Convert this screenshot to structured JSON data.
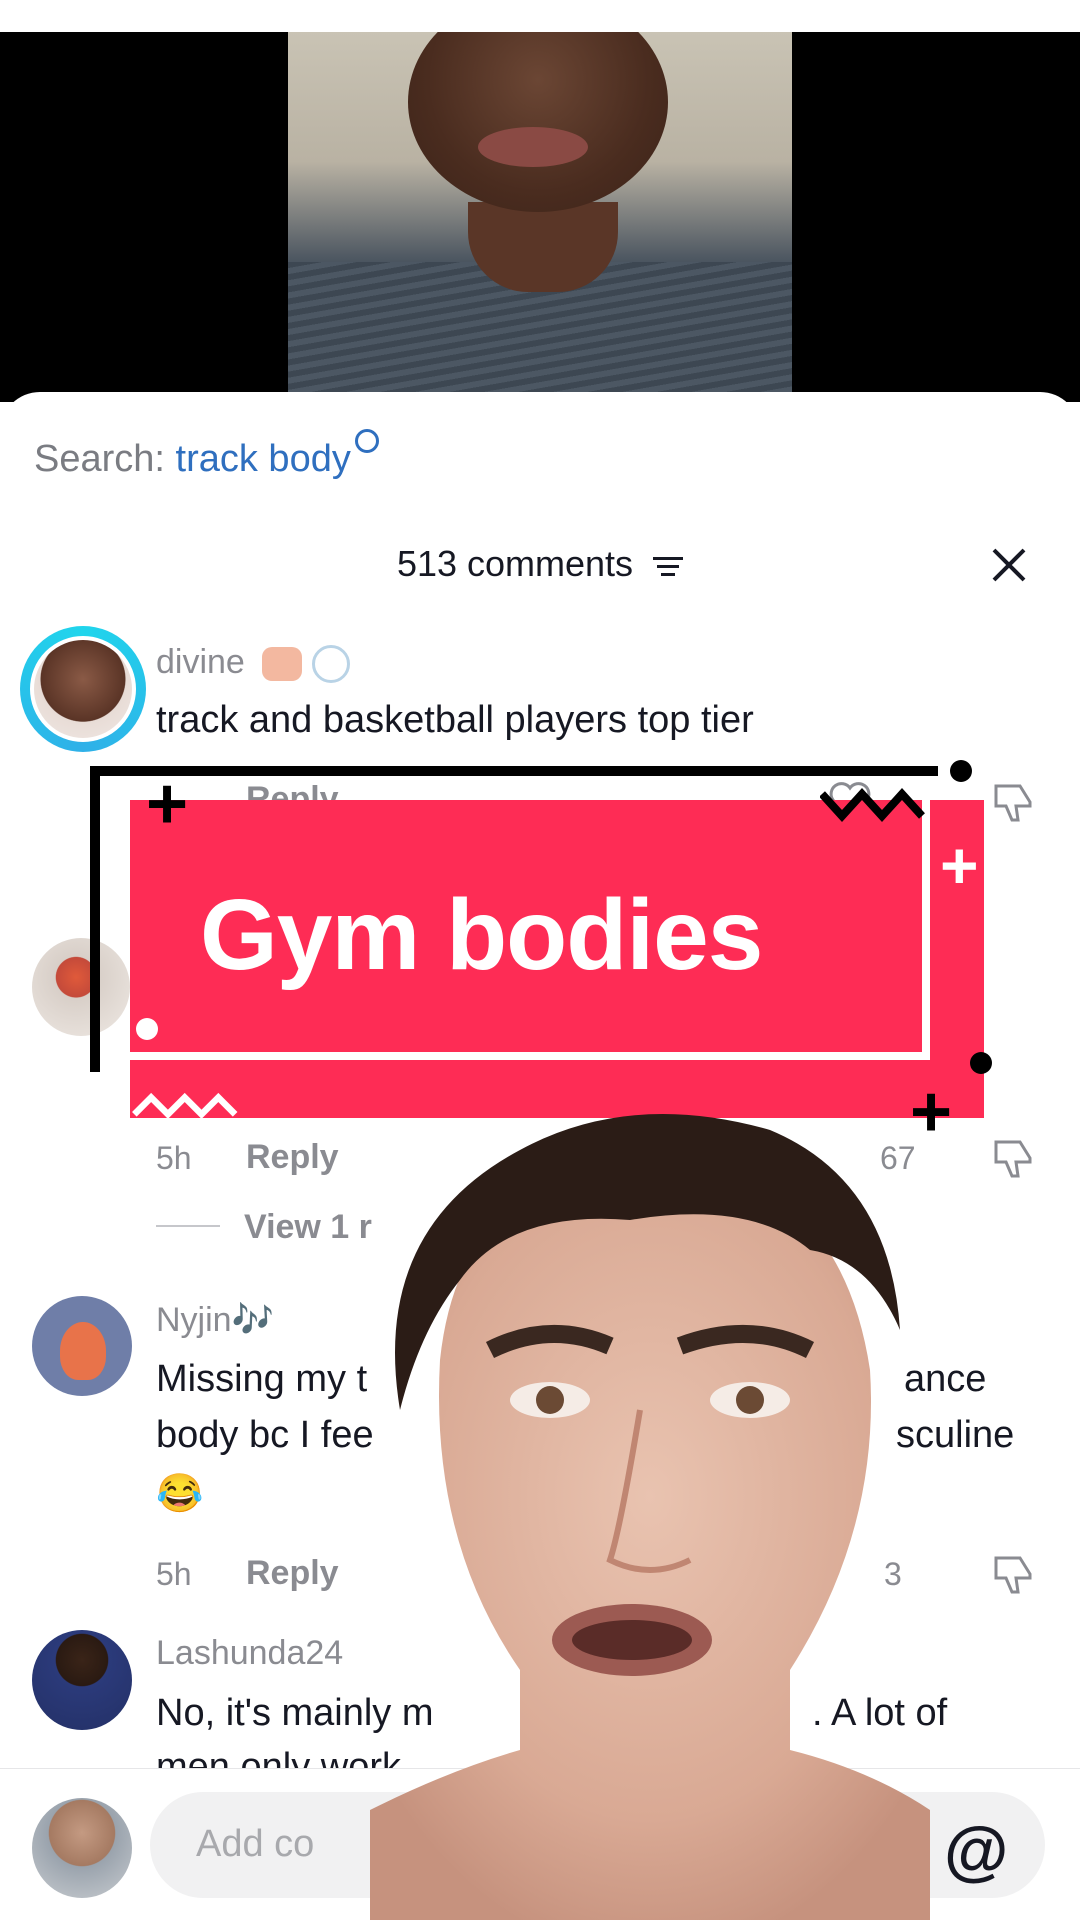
{
  "search": {
    "label": "Search:",
    "query": "track body"
  },
  "header": {
    "comment_count": "513 comments"
  },
  "comments": [
    {
      "username": "divine",
      "text": "track and basketball players top tier",
      "reply_label": "Reply"
    },
    {
      "time": "5h",
      "reply_label": "Reply",
      "likes": "67",
      "view_replies": "View 1 r"
    },
    {
      "username": "Nyjin🎶",
      "text_line1": "Missing my t",
      "text_line1_right": "ance",
      "text_line2": "body bc I fee",
      "text_line2_right": "sculine",
      "emoji": "😂",
      "time": "5h",
      "reply_label": "Reply",
      "likes": "3"
    },
    {
      "username": "Lashunda24",
      "text_left": "No, it's mainly m",
      "text_right": ". A lot of",
      "text_line2": "men only work"
    }
  ],
  "overlay": {
    "banner_text": "Gym bodies"
  },
  "input": {
    "placeholder": "Add co",
    "at_symbol": "@"
  },
  "colors": {
    "accent_red": "#fe2c55",
    "link_blue": "#2f6fbf",
    "ring_teal": "#20d5ec"
  }
}
